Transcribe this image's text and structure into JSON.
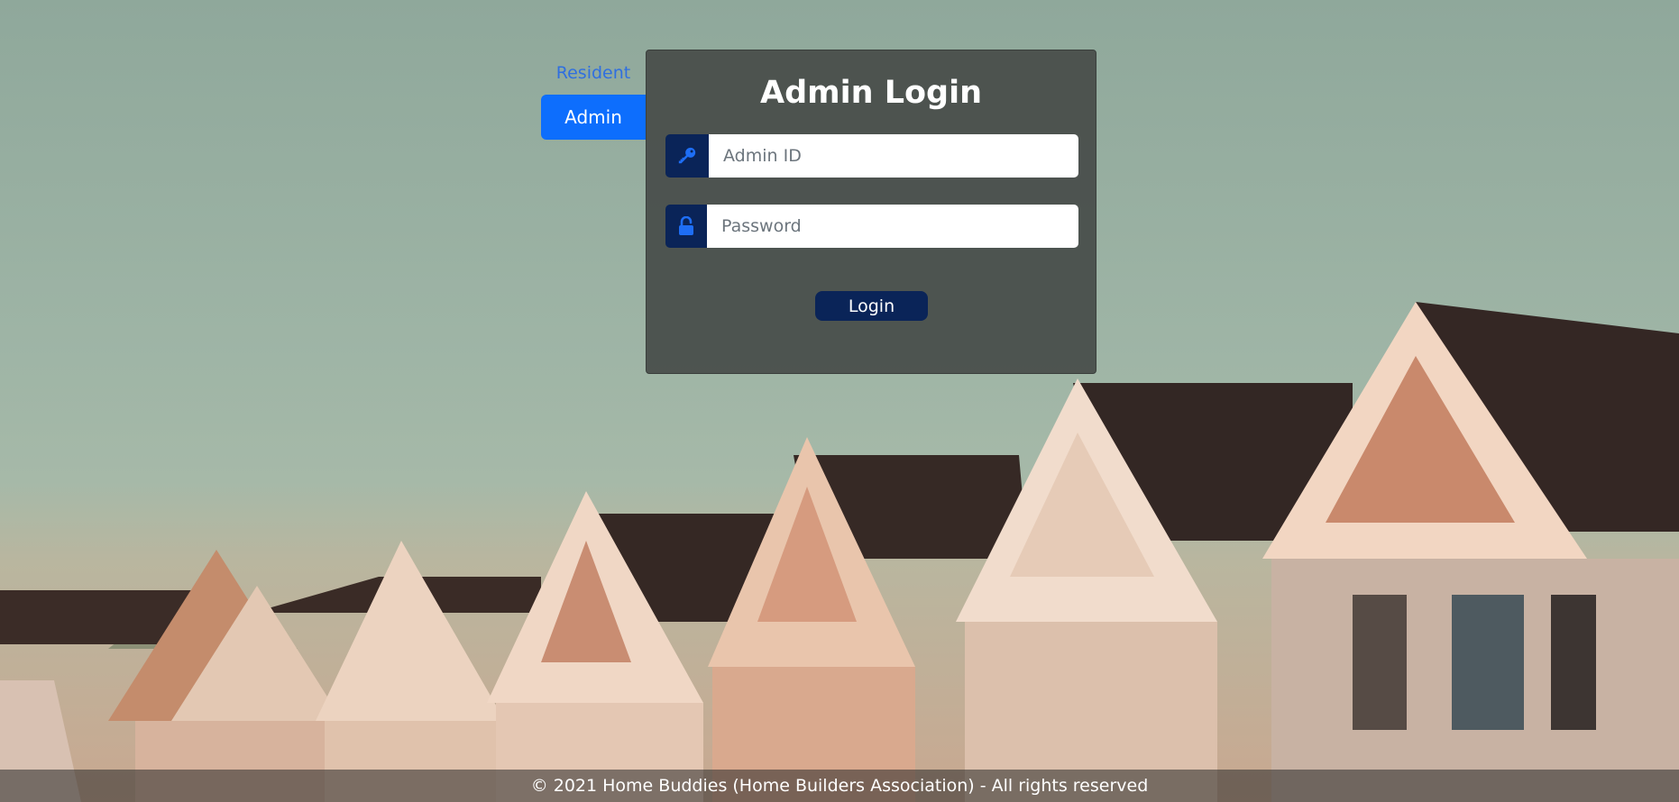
{
  "tabs": {
    "resident_label": "Resident",
    "admin_label": "Admin"
  },
  "login": {
    "title": "Admin Login",
    "admin_id_placeholder": "Admin ID",
    "password_placeholder": "Password",
    "button_label": "Login"
  },
  "icons": {
    "admin_id": "key-icon",
    "password": "unlock-icon"
  },
  "colors": {
    "primary": "#0d6efd",
    "navy": "#0a2458",
    "card_bg": "#484e4a"
  },
  "footer": {
    "text": "© 2021 Home Buddies (Home Builders Association) - All rights reserved"
  }
}
